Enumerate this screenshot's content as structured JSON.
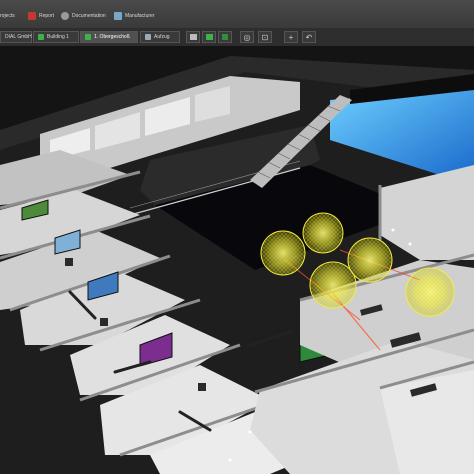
{
  "menu": {
    "objects_label": "rojects",
    "report_label": "Report",
    "documentation_label": "Documentation",
    "manufacturer_label": "Manufacturer"
  },
  "tabs": [
    {
      "label": "DIAL GmbH"
    },
    {
      "label": "Building 1"
    },
    {
      "label": "1. Obergeschoß"
    },
    {
      "label": "Aufzug"
    }
  ],
  "toolbar_icons": [
    "paint-icon",
    "layers-icon",
    "floor-icon",
    "fit-view-icon",
    "zoom-region-icon",
    "zoom-in-icon",
    "rotate-icon"
  ],
  "colors": {
    "accent": "#3aa0ff",
    "luminaire": "#f3f03a",
    "room_floor": "#f0f0ee",
    "atrium_floor": "#0b0b10"
  }
}
